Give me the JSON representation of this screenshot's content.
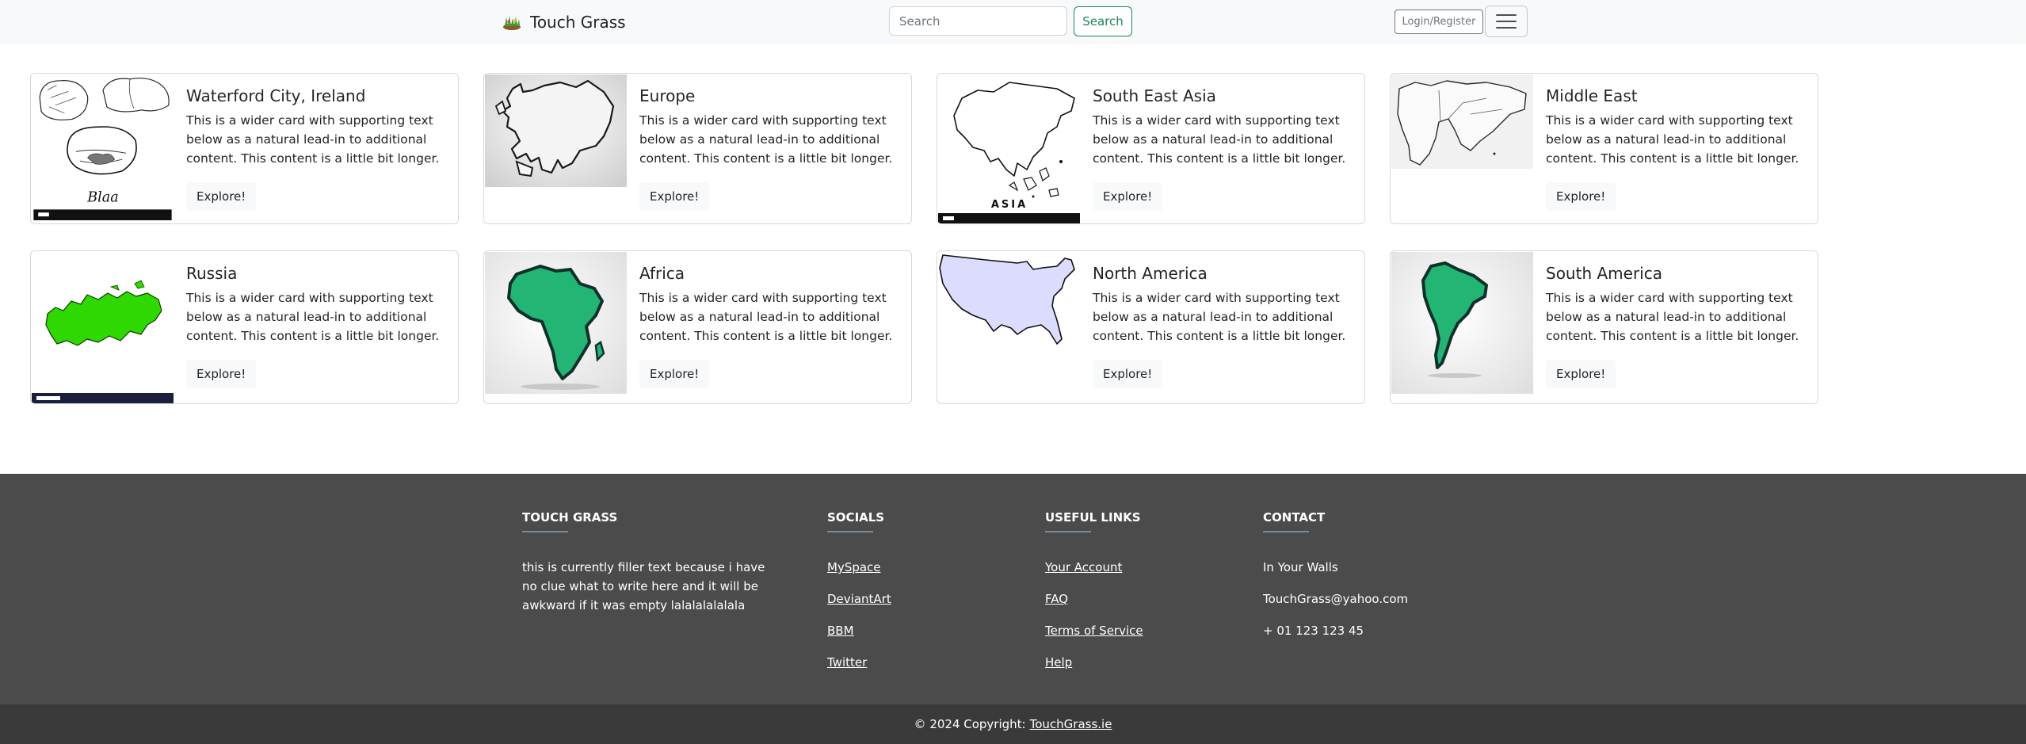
{
  "navbar": {
    "brand": "Touch Grass",
    "search_placeholder": "Search",
    "search_button": "Search",
    "login_button": "Login/Register"
  },
  "cards": [
    {
      "title": "Waterford City, Ireland",
      "text": "This is a wider card with supporting text below as a natural lead-in to additional content. This content is a little bit longer.",
      "button": "Explore!",
      "image": "waterford-sketch-image"
    },
    {
      "title": "Europe",
      "text": "This is a wider card with supporting text below as a natural lead-in to additional content. This content is a little bit longer.",
      "button": "Explore!",
      "image": "europe-map-image"
    },
    {
      "title": "South East Asia",
      "text": "This is a wider card with supporting text below as a natural lead-in to additional content. This content is a little bit longer.",
      "button": "Explore!",
      "image": "asia-map-image",
      "image_caption": "ASIA"
    },
    {
      "title": "Middle East",
      "text": "This is a wider card with supporting text below as a natural lead-in to additional content. This content is a little bit longer.",
      "button": "Explore!",
      "image": "middle-east-map-image"
    },
    {
      "title": "Russia",
      "text": "This is a wider card with supporting text below as a natural lead-in to additional content. This content is a little bit longer.",
      "button": "Explore!",
      "image": "russia-map-image"
    },
    {
      "title": "Africa",
      "text": "This is a wider card with supporting text below as a natural lead-in to additional content. This content is a little bit longer.",
      "button": "Explore!",
      "image": "africa-map-image"
    },
    {
      "title": "North America",
      "text": "This is a wider card with supporting text below as a natural lead-in to additional content. This content is a little bit longer.",
      "button": "Explore!",
      "image": "usa-map-image"
    },
    {
      "title": "South America",
      "text": "This is a wider card with supporting text below as a natural lead-in to additional content. This content is a little bit longer.",
      "button": "Explore!",
      "image": "south-america-map-image"
    }
  ],
  "footer": {
    "about": {
      "heading": "TOUCH GRASS",
      "text": "this is currently filler text because i have no clue what to write here and it will be awkward if it was empty lalalalalalala"
    },
    "socials": {
      "heading": "SOCIALS",
      "links": [
        "MySpace",
        "DeviantArt",
        "BBM",
        "Twitter"
      ]
    },
    "useful_links": {
      "heading": "USEFUL LINKS",
      "links": [
        "Your Account",
        "FAQ",
        "Terms of Service",
        "Help"
      ]
    },
    "contact": {
      "heading": "CONTACT",
      "items": [
        "In Your Walls",
        "TouchGrass@yahoo.com",
        "+ 01 123 123 45"
      ]
    },
    "copyright_text": "© 2024 Copyright:",
    "copyright_link": "TouchGrass.ie"
  },
  "colors": {
    "navbar_bg": "#f8f9fa",
    "accent_green": "#198754",
    "footer_bg": "#4b4b4b",
    "copyright_bg": "#3a3a3a",
    "map_green": "#22b573",
    "russia_green": "#2ed800",
    "usa_fill": "#dcdcff"
  }
}
